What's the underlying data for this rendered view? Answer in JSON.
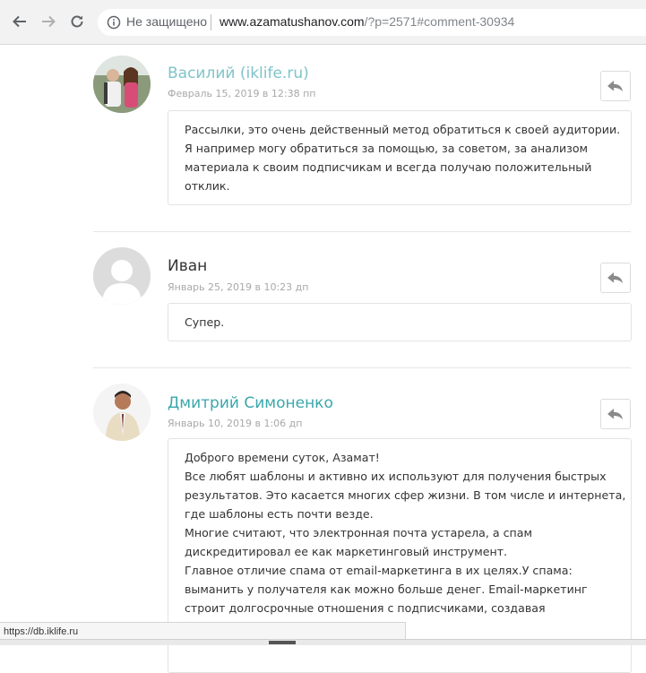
{
  "browser": {
    "security_label": "Не защищено",
    "url_domain": "www.azamatushanov.com",
    "url_path": "/?p=2571#comment-30934",
    "status_url": "https://db.iklife.ru"
  },
  "comments": [
    {
      "author": "Василий (iklife.ru)",
      "date": "Февраль 15, 2019 в 12:38 пп",
      "paragraphs": [
        "Рассылки, это очень действенный метод обратиться к своей аудитории. Я например могу обратиться за помощью, за советом, за анализом материала к своим подписчикам и всегда получаю положительный отклик."
      ]
    },
    {
      "author": "Иван",
      "date": "Январь 25, 2019 в 10:23 дп",
      "paragraphs": [
        "Супер."
      ]
    },
    {
      "author": "Дмитрий Симоненко",
      "date": "Январь 10, 2019 в 1:06 дп",
      "paragraphs": [
        "Доброго времени суток, Азамат!",
        "Все любят шаблоны и активно их используют для получения быстрых результатов. Это касается многих сфер жизни. В том числе и интернета, где шаблоны есть почти везде.",
        "Многие считают, что электронная почта устарела, а спам дискредитировал ее как маркетинговый инструмент.",
        "Главное отличие спама от email-маркетинга в их целях.У спама: выманить у получателя как можно больше денег. Email-маркетинг строит долгосрочные отношения с подписчиками, создавая благоприятные"
      ]
    }
  ],
  "icons": {
    "back": "arrow-left-icon",
    "forward": "arrow-right-icon",
    "reload": "reload-icon",
    "info": "info-icon",
    "reply": "reply-icon"
  }
}
